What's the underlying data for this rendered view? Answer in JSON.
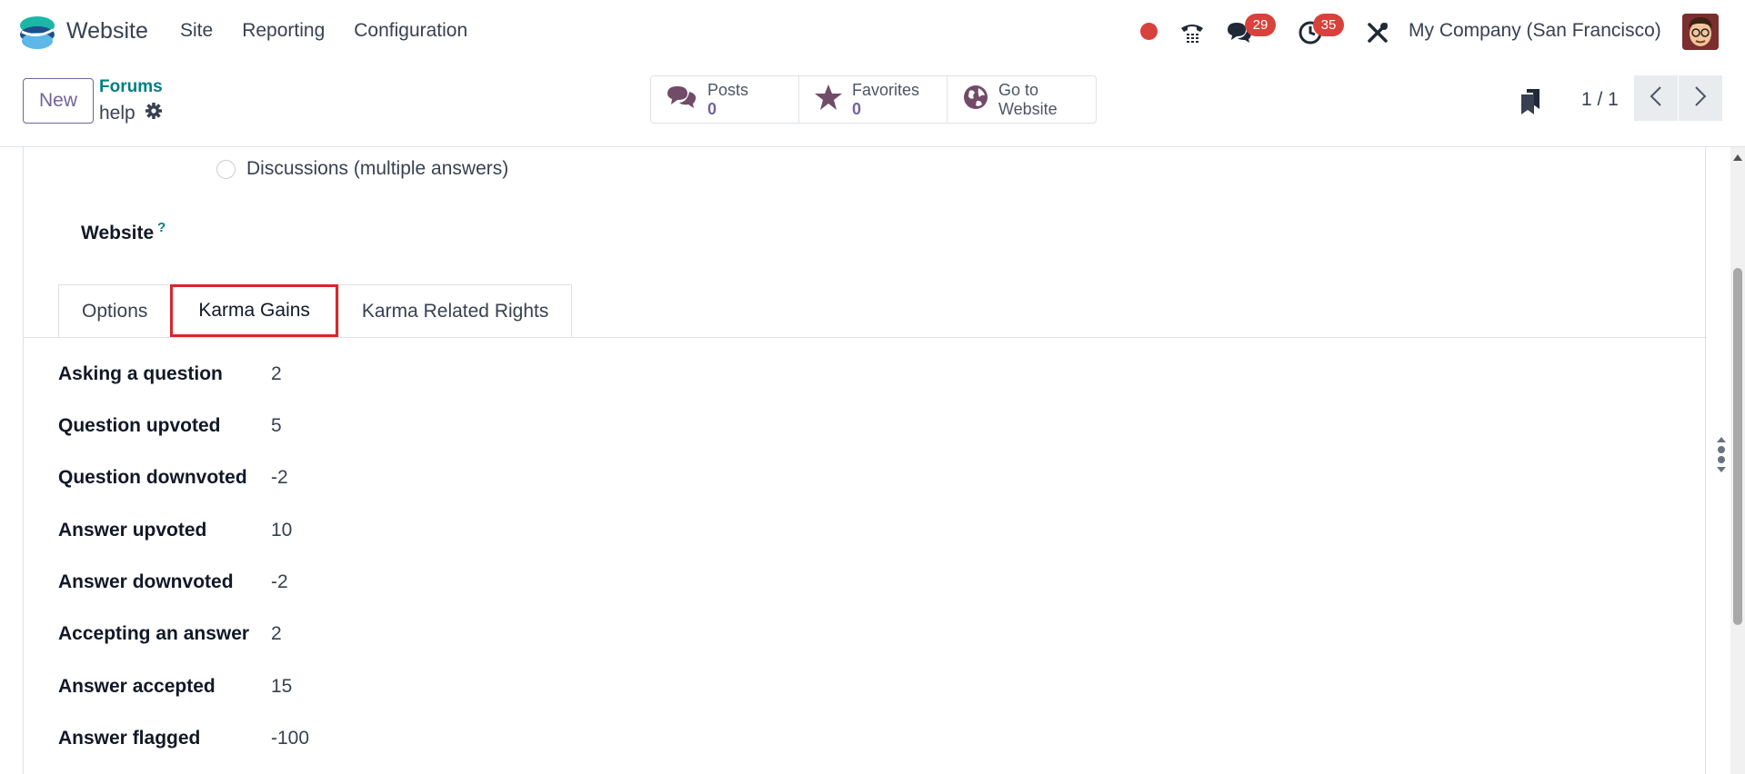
{
  "navbar": {
    "app_name": "Website",
    "menu": [
      "Site",
      "Reporting",
      "Configuration"
    ],
    "chat_badge": "29",
    "activity_badge": "35",
    "company": "My Company (San Francisco)"
  },
  "control": {
    "new_label": "New",
    "breadcrumb": "Forums",
    "record_name": "help",
    "smart_buttons": [
      {
        "label": "Posts",
        "value": "0",
        "icon": "comments-icon"
      },
      {
        "label": "Favorites",
        "value": "0",
        "icon": "star-icon"
      },
      {
        "label": "Go to",
        "value": "Website",
        "icon": "globe-icon"
      }
    ],
    "pager": "1 / 1"
  },
  "form": {
    "radio_label": "Discussions (multiple answers)",
    "website_label": "Website",
    "website_help": "?",
    "tabs": [
      "Options",
      "Karma Gains",
      "Karma Related Rights"
    ],
    "active_tab": "Karma Gains",
    "fields": [
      {
        "label": "Asking a question",
        "value": "2"
      },
      {
        "label": "Question upvoted",
        "value": "5"
      },
      {
        "label": "Question downvoted",
        "value": "-2"
      },
      {
        "label": "Answer upvoted",
        "value": "10"
      },
      {
        "label": "Answer downvoted",
        "value": "-2"
      },
      {
        "label": "Accepting an answer",
        "value": "2"
      },
      {
        "label": "Answer accepted",
        "value": "15"
      },
      {
        "label": "Answer flagged",
        "value": "-100"
      }
    ]
  },
  "colors": {
    "accent": "#71639e",
    "teal": "#017e84",
    "highlight": "#d9252a",
    "badge": "#d9413c"
  }
}
